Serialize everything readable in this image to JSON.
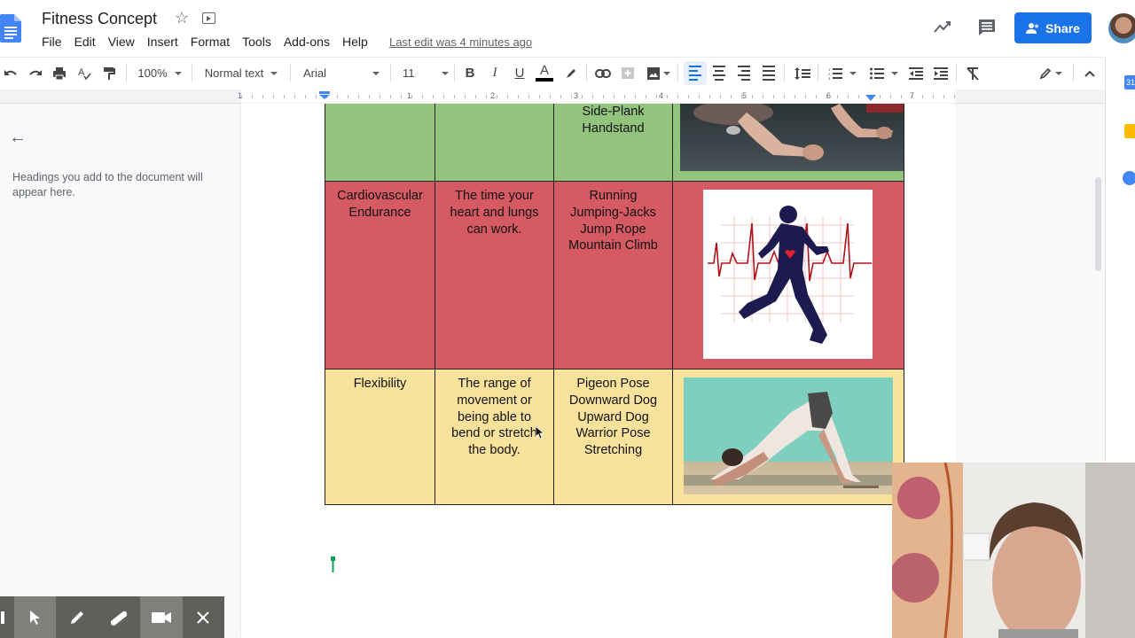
{
  "app": {
    "doc_title": "Fitness Concept",
    "last_edit": "Last edit was 4 minutes ago",
    "menu": [
      "File",
      "Edit",
      "View",
      "Insert",
      "Format",
      "Tools",
      "Add-ons",
      "Help"
    ],
    "share_label": "Share"
  },
  "toolbar": {
    "zoom": "100%",
    "style": "Normal text",
    "font": "Arial",
    "font_size": "11",
    "bold": "B",
    "italic": "I",
    "underline": "U",
    "text_color": "A",
    "text_color_value": "#000000",
    "accent_color": "#1a73e8"
  },
  "ruler": {
    "labels": [
      "1",
      "1",
      "2",
      "3",
      "4",
      "5",
      "6",
      "7"
    ]
  },
  "outline": {
    "hint": "Headings you add to the document will appear here."
  },
  "table": {
    "rows": [
      {
        "color": "#93c47d",
        "component": "",
        "definition": "",
        "exercises": [
          "Side-Plank",
          "Handstand"
        ],
        "image": "people-planking-photo"
      },
      {
        "color": "#d55a63",
        "component": "Cardiovascular Endurance",
        "definition": "The time your heart and lungs can work.",
        "exercises": [
          "Running",
          "Jumping-Jacks",
          "Jump Rope",
          "Mountain Climb"
        ],
        "image": "runner-heartbeat-illustration"
      },
      {
        "color": "#f9e29c",
        "component": "Flexibility",
        "definition": "The range of movement or being able to bend or stretch the body.",
        "exercises": [
          "Pigeon Pose",
          "Downward Dog",
          "Upward Dog",
          "Warrior Pose",
          "Stretching"
        ],
        "image": "downward-dog-yoga-photo"
      }
    ]
  },
  "side_panel": {
    "calendar_label": "31"
  },
  "recorder": {
    "tools": [
      "pointer",
      "pen",
      "highlighter",
      "camera",
      "close"
    ]
  }
}
